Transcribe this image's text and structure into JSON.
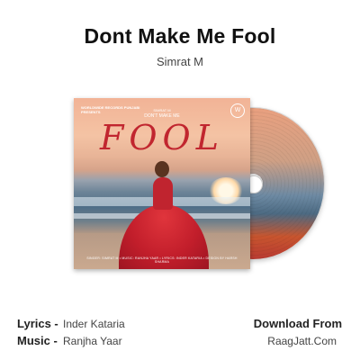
{
  "song": {
    "title": "Dont Make Me Fool",
    "artist": "Simrat M"
  },
  "cover": {
    "label_top": "WORLDWIDE RECORDS PUNJABI",
    "label_sub": "PRESENTS",
    "singer_line": "SIMRAT M",
    "tagline": "DON'T MAKE ME",
    "big_word": "FOOL",
    "credits": "SINGER: SIMRAT M • MUSIC: RANJHA YAAR • LYRICS: INDER KATARIA • DESIGN BY HARSH SHARMA"
  },
  "credits": {
    "lyrics_label": "Lyrics -",
    "lyrics_value": "Inder Kataria",
    "music_label": "Music -",
    "music_value": "Ranjha Yaar"
  },
  "download": {
    "heading": "Download From",
    "site": "RaagJatt.Com"
  }
}
